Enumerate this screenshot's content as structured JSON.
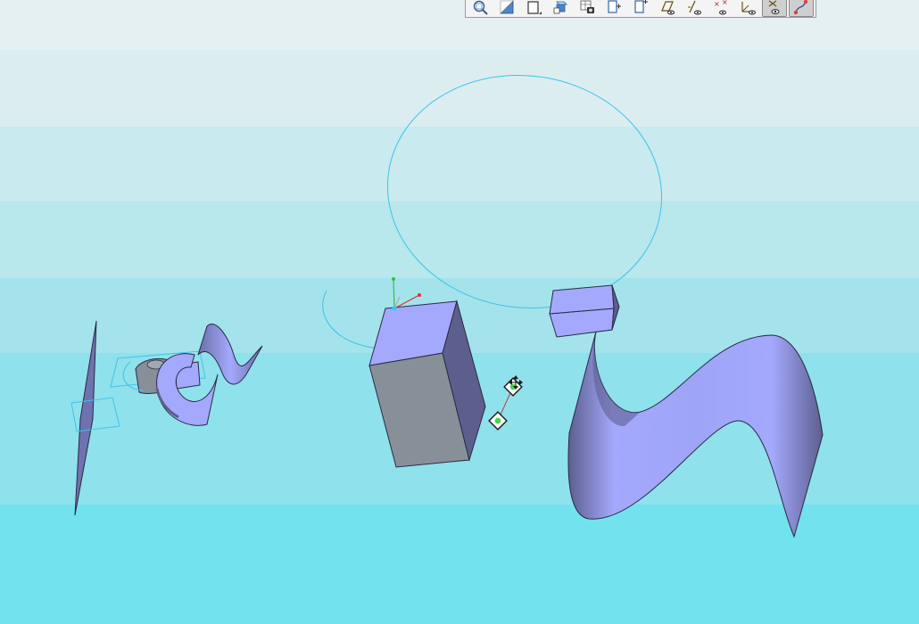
{
  "viewport": {
    "background_bands": [
      "#e5f0f1",
      "#dcedf0",
      "#c9eaee",
      "#b8e7ec",
      "#a5e3ec",
      "#8fe1ec",
      "#72e2ef"
    ]
  },
  "colors": {
    "solid_face_light": "#a4a9fd",
    "solid_face_dark": "#5c5f8e",
    "solid_face_gray": "#879099",
    "wire_cyan": "#3ec4ea",
    "edge": "#2a2a44",
    "handle_green": "#46d34a",
    "axis_x": "#e03030",
    "axis_y": "#30c040",
    "axis_z": "#22d4f0"
  },
  "toolbar": {
    "buttons": [
      {
        "icon": "zoom-icon",
        "active": false
      },
      {
        "icon": "shading-icon",
        "active": false
      },
      {
        "icon": "view-cube-icon",
        "active": false
      },
      {
        "icon": "multi-view-icon",
        "active": false
      },
      {
        "icon": "render-table-icon",
        "active": false
      },
      {
        "icon": "plane-normal-icon",
        "active": false
      },
      {
        "icon": "plane-offset-icon",
        "active": false
      },
      {
        "icon": "show-planes-icon",
        "active": false
      },
      {
        "icon": "show-axes-icon",
        "active": false
      },
      {
        "icon": "show-points-icon",
        "active": false
      },
      {
        "icon": "show-csys-icon",
        "active": false
      },
      {
        "icon": "spin-center-icon",
        "active": true
      },
      {
        "icon": "annotation-display-icon",
        "active": true
      }
    ]
  }
}
